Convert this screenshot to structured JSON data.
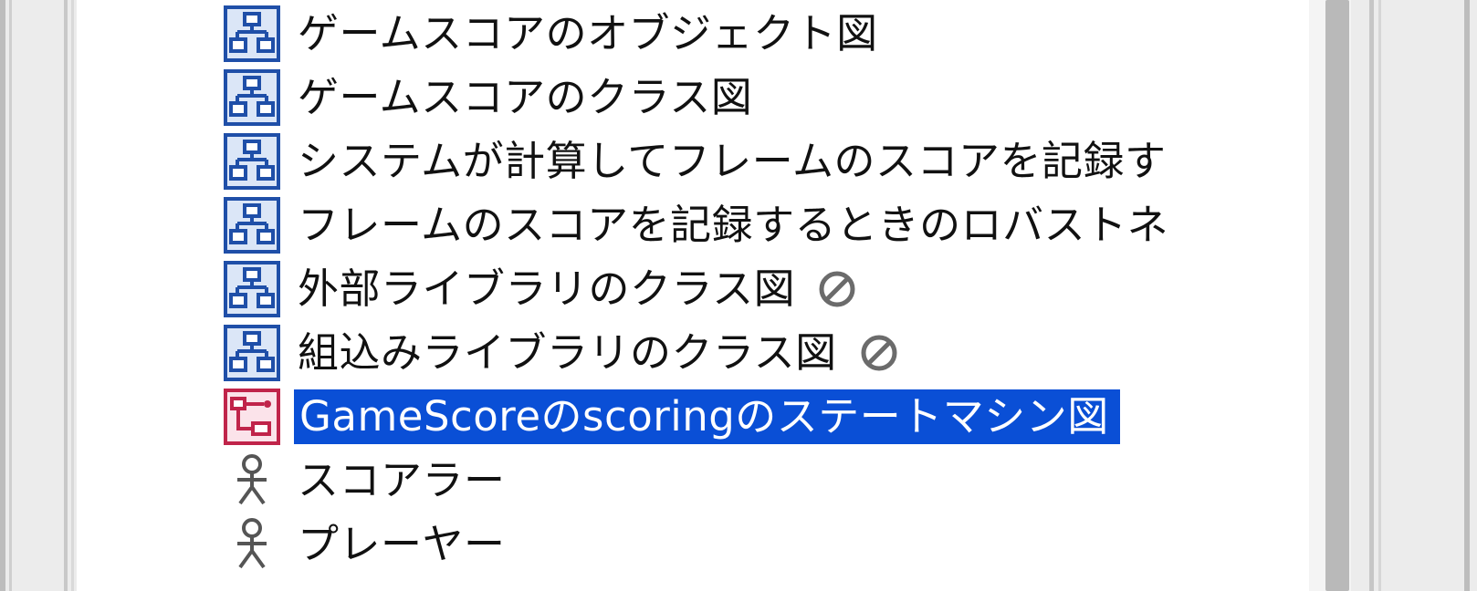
{
  "tree": {
    "items": [
      {
        "label": "ゲームスコアのオブジェクト図",
        "icon": "class-diagram-icon",
        "selected": false,
        "disabled": false
      },
      {
        "label": "ゲームスコアのクラス図",
        "icon": "class-diagram-icon",
        "selected": false,
        "disabled": false
      },
      {
        "label": "システムが計算してフレームのスコアを記録す",
        "icon": "class-diagram-icon",
        "selected": false,
        "disabled": false
      },
      {
        "label": "フレームのスコアを記録するときのロバストネ",
        "icon": "class-diagram-icon",
        "selected": false,
        "disabled": false
      },
      {
        "label": "外部ライブラリのクラス図",
        "icon": "class-diagram-icon",
        "selected": false,
        "disabled": true
      },
      {
        "label": "組込みライブラリのクラス図",
        "icon": "class-diagram-icon",
        "selected": false,
        "disabled": true
      },
      {
        "label": "GameScoreのscoringのステートマシン図",
        "icon": "state-machine-diagram-icon",
        "selected": true,
        "disabled": false
      },
      {
        "label": "スコアラー",
        "icon": "actor-icon",
        "selected": false,
        "disabled": false
      },
      {
        "label": "プレーヤー",
        "icon": "actor-icon",
        "selected": false,
        "disabled": false
      }
    ]
  },
  "colors": {
    "selection": "#0a4fd6",
    "diagram_icon": "#1f4fa8",
    "diagram_icon_fill": "#dbe6f7",
    "state_icon": "#c0244a",
    "state_icon_fill": "#fbe3ea",
    "actor_icon": "#555555",
    "prohibit_icon": "#6b6b6b"
  }
}
